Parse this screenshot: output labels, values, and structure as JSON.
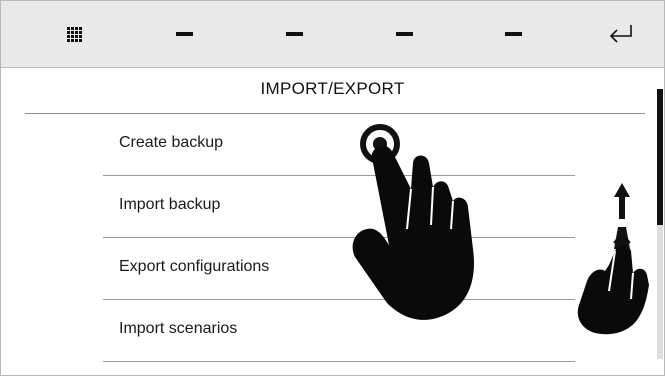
{
  "toolbar": {
    "buttons": [
      {
        "icon": "grid-icon"
      },
      {
        "icon": "dash-icon"
      },
      {
        "icon": "dash-icon"
      },
      {
        "icon": "dash-icon"
      },
      {
        "icon": "dash-icon"
      },
      {
        "icon": "return-arrow-icon"
      }
    ]
  },
  "page": {
    "title": "IMPORT/EXPORT"
  },
  "menu": {
    "items": [
      {
        "label": "Create backup"
      },
      {
        "label": "Import backup"
      },
      {
        "label": "Export configurations"
      },
      {
        "label": "Import scenarios"
      }
    ]
  },
  "gestures": {
    "tap_hint": "tap-gesture-icon",
    "scroll_hint": "swipe-vertical-gesture-icon"
  },
  "colors": {
    "toolbar_bg": "#e9e9e9",
    "text": "#111111",
    "scroll_thumb": "#111111"
  }
}
